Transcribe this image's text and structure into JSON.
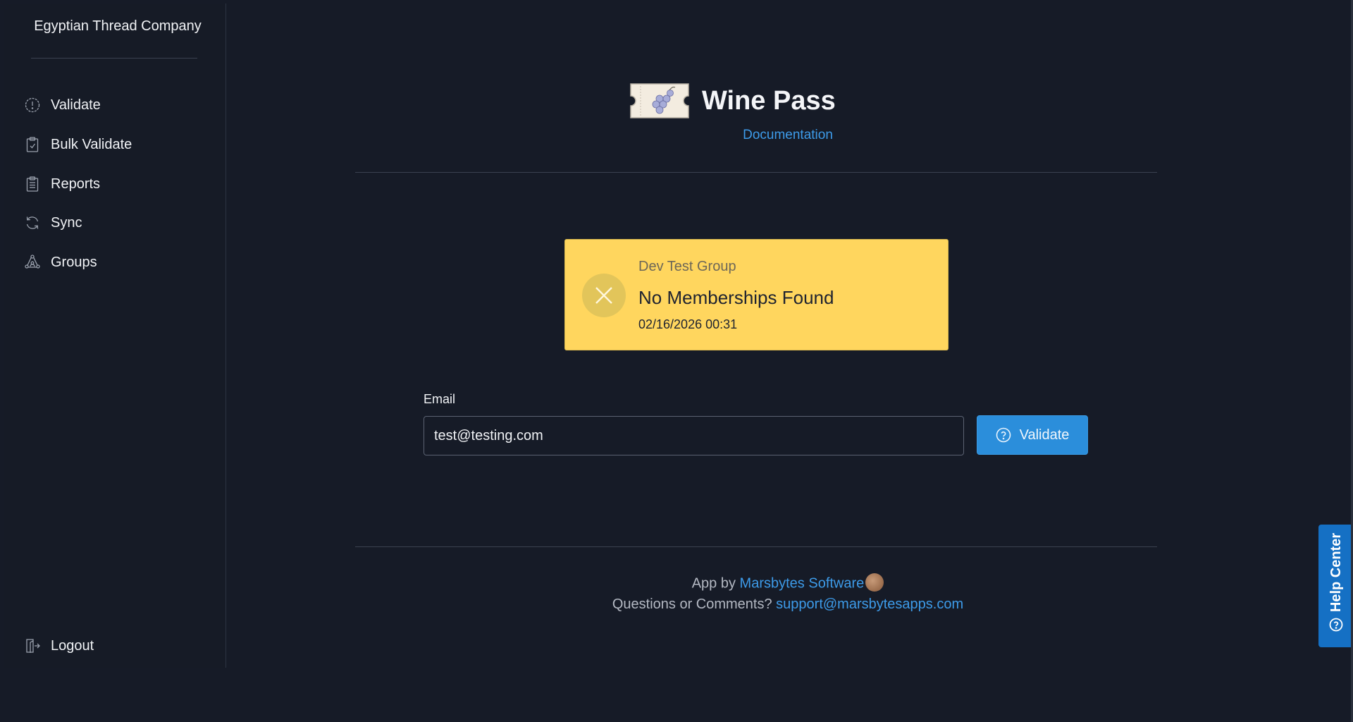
{
  "sidebar": {
    "store_name": "Egyptian Thread Company",
    "items": [
      {
        "label": "Validate",
        "icon": "alert-circle-icon"
      },
      {
        "label": "Bulk Validate",
        "icon": "clipboard-check-icon"
      },
      {
        "label": "Reports",
        "icon": "clipboard-list-icon"
      },
      {
        "label": "Sync",
        "icon": "refresh-icon"
      },
      {
        "label": "Groups",
        "icon": "network-icon"
      }
    ],
    "logout_label": "Logout"
  },
  "header": {
    "title": "Wine Pass",
    "doc_link": "Documentation"
  },
  "result": {
    "group": "Dev Test Group",
    "message": "No Memberships Found",
    "timestamp": "02/16/2026 00:31",
    "status_color": "#ffd65e"
  },
  "form": {
    "email_label": "Email",
    "email_value": "test@testing.com",
    "validate_label": "Validate"
  },
  "footer": {
    "app_by": "App by ",
    "company": "Marsbytes Software",
    "questions": "Questions or Comments? ",
    "support_email": "support@marsbytesapps.com"
  },
  "help_center": {
    "label": "Help Center"
  },
  "colors": {
    "accent": "#2b8edb",
    "link": "#3d9be9",
    "background": "#161b27"
  }
}
